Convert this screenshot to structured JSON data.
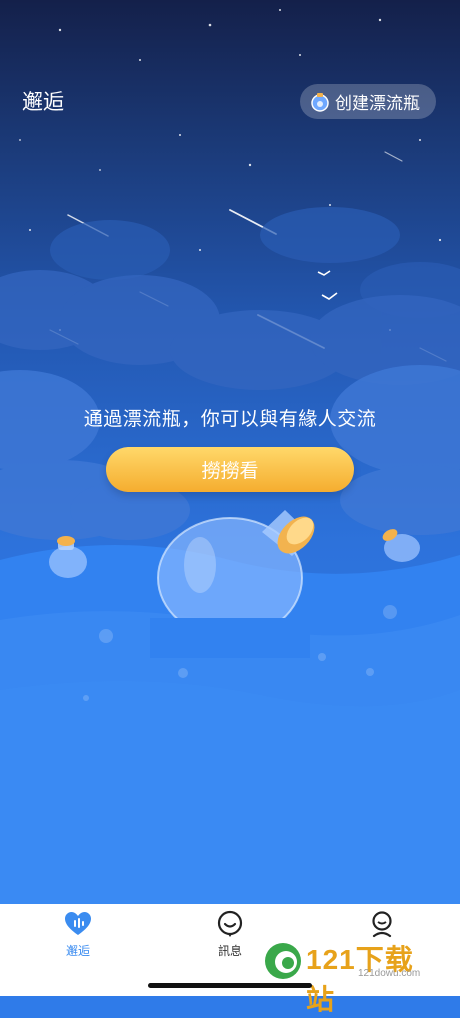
{
  "header": {
    "title": "邂逅",
    "create_button_label": "创建漂流瓶"
  },
  "main": {
    "tagline": "通過漂流瓶，你可以與有緣人交流",
    "fish_button_label": "撈撈看"
  },
  "tabbar": {
    "tabs": [
      {
        "label": "邂逅",
        "icon": "heart-wave-icon",
        "active": true
      },
      {
        "label": "訊息",
        "icon": "smile-chat-icon",
        "active": false
      },
      {
        "label": "",
        "icon": "profile-icon",
        "active": false
      }
    ]
  },
  "watermark": {
    "text": "121下载站",
    "url": "121dowu.com"
  },
  "colors": {
    "accent": "#3b8cf0",
    "button": "#f5ad2f",
    "sky_top": "#14204a",
    "sea": "#2f7fee"
  }
}
